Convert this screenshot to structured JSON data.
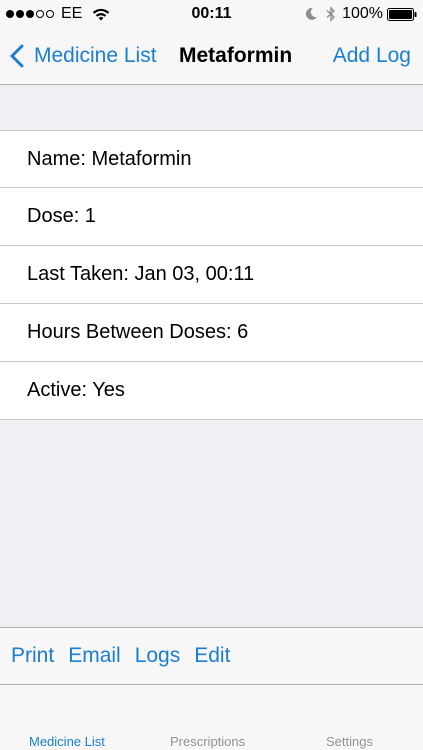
{
  "status_bar": {
    "signal_bars_filled": 3,
    "signal_bars_total": 5,
    "carrier": "EE",
    "wifi_icon": "wifi-icon",
    "time": "00:11",
    "moon_icon": "moon-icon",
    "bluetooth_icon": "bluetooth-icon",
    "battery_percent": "100%",
    "battery_level": 1.0
  },
  "nav": {
    "back_label": "Medicine List",
    "title": "Metaformin",
    "right_action": "Add Log",
    "accent_color": "#1a7ed4"
  },
  "details": {
    "rows": [
      {
        "text": "Name: Metaformin"
      },
      {
        "text": "Dose: 1"
      },
      {
        "text": "Last Taken: Jan 03, 00:11"
      },
      {
        "text": "Hours Between Doses: 6"
      },
      {
        "text": "Active: Yes"
      }
    ]
  },
  "toolbar": {
    "print_label": "Print",
    "email_label": "Email",
    "logs_label": "Logs",
    "edit_label": "Edit"
  },
  "tabs": [
    {
      "label": "Medicine List",
      "active": true
    },
    {
      "label": "Prescriptions",
      "active": false
    },
    {
      "label": "Settings",
      "active": false
    }
  ]
}
